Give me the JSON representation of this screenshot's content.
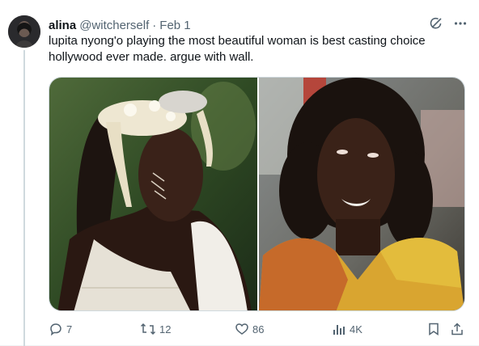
{
  "author": {
    "name": "alina",
    "handle": "@witcherself",
    "date": "Feb 1"
  },
  "post": {
    "text": "lupita nyong'o playing the most beautiful woman is best casting choice hollywood ever made. argue with wall."
  },
  "media": {
    "count": 2,
    "images": [
      {
        "kind": "photo",
        "subject": "woman-with-white-floral-headdress"
      },
      {
        "kind": "photo",
        "subject": "woman-in-yellow-orange-dress"
      }
    ]
  },
  "metrics": {
    "replies": "7",
    "reposts": "12",
    "likes": "86",
    "views": "4K"
  },
  "icons": {
    "header": [
      "grok-icon",
      "more-icon"
    ],
    "actions": [
      "reply-icon",
      "repost-icon",
      "like-icon",
      "views-icon",
      "bookmark-icon",
      "share-icon"
    ]
  },
  "colors": {
    "text": "#0f1419",
    "secondary": "#536471",
    "thread_line": "#cfd9de"
  }
}
